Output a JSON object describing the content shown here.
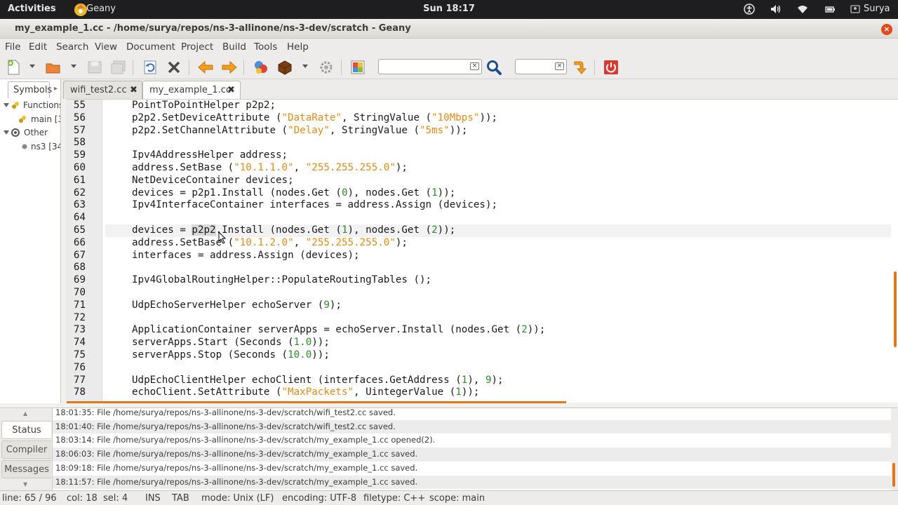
{
  "top_panel": {
    "activities": "Activities",
    "app_name": "Geany",
    "clock": "Sun 18:17",
    "user": "Surya"
  },
  "window": {
    "title": "my_example_1.cc - /home/surya/repos/ns-3-allinone/ns-3-dev/scratch - Geany",
    "close": "×"
  },
  "menu": [
    "File",
    "Edit",
    "Search",
    "View",
    "Document",
    "Project",
    "Build",
    "Tools",
    "Help"
  ],
  "sidebar": {
    "tab_label": "Symbols",
    "tree": [
      {
        "label": "Functions"
      },
      {
        "label": "main [3"
      },
      {
        "label": "Other"
      },
      {
        "label": "ns3 [34"
      }
    ]
  },
  "tabs": [
    {
      "label": "wifi_test2.cc",
      "close": "✖"
    },
    {
      "label": "my_example_1.cc",
      "close": "✖"
    }
  ],
  "editor": {
    "lines": [
      {
        "n": "55",
        "t": "PointToPointHelper p2p2;"
      },
      {
        "n": "56",
        "a": "p2p2.SetDeviceAttribute (",
        "s1": "\"DataRate\"",
        "b": ", StringValue (",
        "s2": "\"10Mbps\"",
        "c": "));"
      },
      {
        "n": "57",
        "a": "p2p2.SetChannelAttribute (",
        "s1": "\"Delay\"",
        "b": ", StringValue (",
        "s2": "\"5ms\"",
        "c": "));"
      },
      {
        "n": "58",
        "t": ""
      },
      {
        "n": "59",
        "t": "Ipv4AddressHelper address;"
      },
      {
        "n": "60",
        "a": "address.SetBase (",
        "s1": "\"10.1.1.0\"",
        "b": ", ",
        "s2": "\"255.255.255.0\"",
        "c": ");"
      },
      {
        "n": "61",
        "t": "NetDeviceContainer devices;"
      },
      {
        "n": "62",
        "a": "devices = p2p1.Install (nodes.Get (",
        "n1": "0",
        "b": "), nodes.Get (",
        "n2": "1",
        "c": "));"
      },
      {
        "n": "63",
        "t": "Ipv4InterfaceContainer interfaces = address.Assign (devices);"
      },
      {
        "n": "64",
        "t": ""
      },
      {
        "n": "65",
        "pre": "devices = ",
        "selw": "p2p2",
        "a": ".Install (nodes.Get (",
        "n1": "1",
        "b": "), nodes.Get (",
        "n2": "2",
        "c": "));"
      },
      {
        "n": "66",
        "a": "address.SetBase (",
        "s1": "\"10.1.2.0\"",
        "b": ", ",
        "s2": "\"255.255.255.0\"",
        "c": ");"
      },
      {
        "n": "67",
        "t": "interfaces = address.Assign (devices);"
      },
      {
        "n": "68",
        "t": ""
      },
      {
        "n": "69",
        "t": "Ipv4GlobalRoutingHelper::PopulateRoutingTables ();"
      },
      {
        "n": "70",
        "t": ""
      },
      {
        "n": "71",
        "a": "UdpEchoServerHelper echoServer (",
        "n1": "9",
        "c": ");"
      },
      {
        "n": "72",
        "t": ""
      },
      {
        "n": "73",
        "a": "ApplicationContainer serverApps = echoServer.Install (nodes.Get (",
        "n1": "2",
        "c": "));"
      },
      {
        "n": "74",
        "a": "serverApps.Start (Seconds (",
        "n1": "1.0",
        "c": "));"
      },
      {
        "n": "75",
        "a": "serverApps.Stop (Seconds (",
        "n1": "10.0",
        "c": "));"
      },
      {
        "n": "76",
        "t": ""
      },
      {
        "n": "77",
        "a": "UdpEchoClientHelper echoClient (interfaces.GetAddress (",
        "n1": "1",
        "b": "), ",
        "n2": "9",
        "c": ");"
      },
      {
        "n": "78",
        "a": "echoClient.SetAttribute (",
        "s1": "\"MaxPackets\"",
        "b": ", UintegerValue (",
        "n2": "1",
        "c": "));"
      }
    ]
  },
  "messages": {
    "tabs": [
      "Status",
      "Compiler",
      "Messages"
    ],
    "rows": [
      "18:01:35: File /home/surya/repos/ns-3-allinone/ns-3-dev/scratch/wifi_test2.cc saved.",
      "18:01:40: File /home/surya/repos/ns-3-allinone/ns-3-dev/scratch/wifi_test2.cc saved.",
      "18:03:14: File /home/surya/repos/ns-3-allinone/ns-3-dev/scratch/my_example_1.cc opened(2).",
      "18:06:03: File /home/surya/repos/ns-3-allinone/ns-3-dev/scratch/my_example_1.cc saved.",
      "18:09:18: File /home/surya/repos/ns-3-allinone/ns-3-dev/scratch/my_example_1.cc saved.",
      "18:11:57: File /home/surya/repos/ns-3-allinone/ns-3-dev/scratch/my_example_1.cc saved."
    ]
  },
  "statusbar": {
    "line": "line: 65 / 96",
    "col": "col: 18",
    "sel": "sel: 4",
    "ins": "INS",
    "tab": "TAB",
    "mode": "mode: Unix (LF)",
    "encoding": "encoding: UTF-8",
    "filetype": "filetype: C++",
    "scope": "scope: main"
  },
  "colors": {
    "string": "#e08b1a",
    "number": "#2e8b2e",
    "accent": "#e0781a",
    "close": "#df4a16"
  }
}
